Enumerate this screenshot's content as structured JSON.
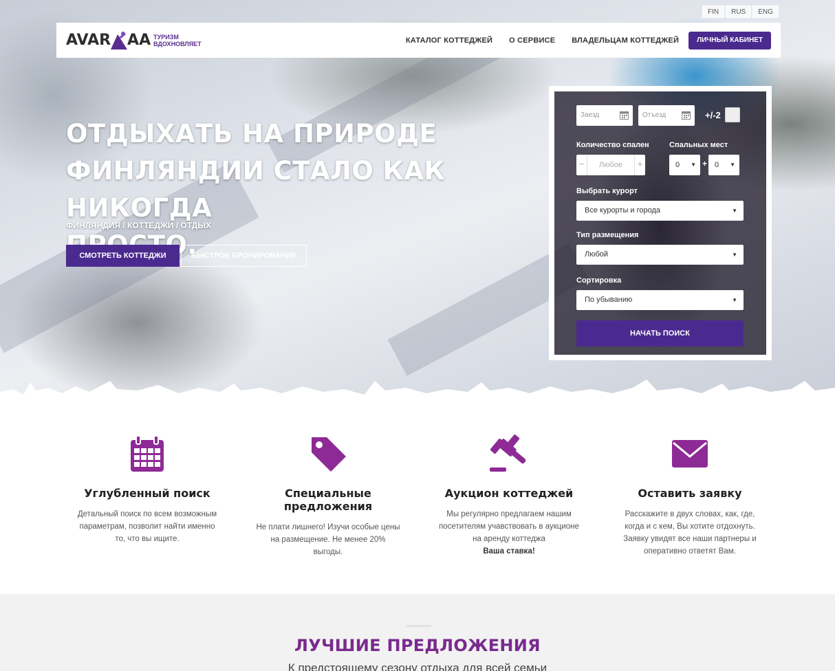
{
  "languages": [
    "FIN",
    "RUS",
    "ENG"
  ],
  "nav": {
    "logo_left": "AVAR",
    "logo_right": "AA",
    "tagline_1": "ТУРИЗМ",
    "tagline_2": "ВДОХНОВЛЯЕТ",
    "links": [
      "КАТАЛОГ КОТТЕДЖЕЙ",
      "О СЕРВИСЕ",
      "ВЛАДЕЛЬЦАМ КОТТЕДЖЕЙ"
    ],
    "cta": "ЛИЧНЫЙ КАБИНЕТ"
  },
  "hero": {
    "title_1": "ОТДЫХАТЬ НА ПРИРОДЕ",
    "title_2": "ФИНЛЯНДИИ СТАЛО КАК НИКОГДА",
    "title_3": "ПРОСТО.",
    "subtitle": "ФИНЛЯНДИЯ / КОТТЕДЖИ / ОТДЫХ",
    "btn_primary": "СМОТРЕТЬ КОТТЕДЖИ",
    "btn_secondary": "БЫСТРОЕ БРОНИРОВАНИЕ"
  },
  "search": {
    "checkin_placeholder": "Заезд",
    "checkout_placeholder": "Отъезд",
    "flex_label": "+/-2",
    "bedrooms_label": "Количество спален",
    "bedrooms_value": "Любое",
    "berths_label": "Спальных мест",
    "berths_a": "0",
    "berths_b": "0",
    "resort_label": "Выбрать курорт",
    "resort_value": "Все курорты и города",
    "type_label": "Тип размещения",
    "type_value": "Любой",
    "sort_label": "Сортировка",
    "sort_value": "По убыванию",
    "submit": "НАЧАТЬ ПОИСК"
  },
  "features": [
    {
      "icon": "calendar-icon",
      "title": "Углубленный поиск",
      "text": "Детальный поиск по всем возможным параметрам, позволит найти именно то, что вы ищите."
    },
    {
      "icon": "tag-icon",
      "title_1": "Специальные",
      "title_2": "предложения",
      "text": "Не плати лишнего! Изучи особые цены на размещение. Не менее 20% выгоды."
    },
    {
      "icon": "gavel-icon",
      "title": "Аукцион коттеджей",
      "text": "Мы регулярно предлагаем нашим посетителям учавствовать в аукционе на аренду коттеджа",
      "bold": "Ваша ставка!"
    },
    {
      "icon": "envelope-icon",
      "title": "Оставить заявку",
      "text": "Расскажите в двух словах, как, где, когда и с кем, Вы хотите отдохнуть. Заявку увидят все наши партнеры и оперативно ответят Вам."
    }
  ],
  "offers": {
    "title": "ЛУЧШИЕ ПРЕДЛОЖЕНИЯ",
    "subtitle": "К предстоящему сезону отдыха для всей семьи"
  },
  "colors": {
    "brand": "#4b2a8f",
    "icon": "#8e2a96",
    "offers_title": "#7a2a8e"
  }
}
